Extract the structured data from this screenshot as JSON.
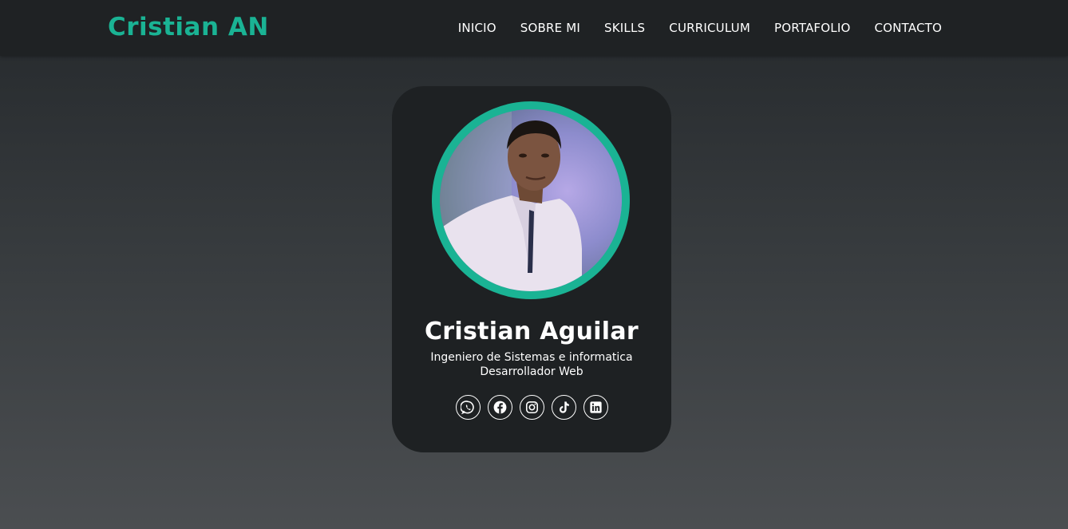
{
  "header": {
    "logo": "Cristian AN",
    "nav": [
      {
        "label": "INICIO"
      },
      {
        "label": "SOBRE MI"
      },
      {
        "label": "SKILLS"
      },
      {
        "label": "CURRICULUM"
      },
      {
        "label": "PORTAFOLIO"
      },
      {
        "label": "CONTACTO"
      }
    ]
  },
  "profile": {
    "name": "Cristian Aguilar",
    "role_line1": "Ingeniero de Sistemas e informatica",
    "role_line2": "Desarrollador Web",
    "socials": [
      {
        "icon": "whatsapp-icon"
      },
      {
        "icon": "facebook-icon"
      },
      {
        "icon": "instagram-icon"
      },
      {
        "icon": "tiktok-icon"
      },
      {
        "icon": "linkedin-icon"
      }
    ]
  },
  "colors": {
    "accent": "#1ab394",
    "header_bg": "#1f2224",
    "card_bg": "#1e2123",
    "text": "#ffffff"
  }
}
